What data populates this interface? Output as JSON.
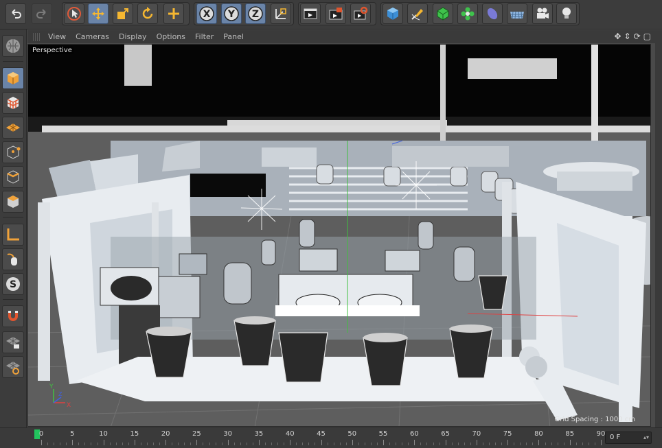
{
  "toolbar": {
    "buttons": [
      {
        "icon": "undo-icon",
        "enabled": true
      },
      {
        "icon": "redo-icon",
        "enabled": false
      },
      {
        "icon": "selection-arrow-icon",
        "enabled": true
      },
      {
        "icon": "move-icon",
        "active": true
      },
      {
        "icon": "scale-icon",
        "enabled": true
      },
      {
        "icon": "rotate-icon",
        "enabled": true
      },
      {
        "icon": "plus-move-icon",
        "enabled": true
      },
      {
        "icon": "x-axis-lock-icon",
        "label": "X"
      },
      {
        "icon": "y-axis-lock-icon",
        "label": "Y"
      },
      {
        "icon": "z-axis-lock-icon",
        "label": "Z"
      },
      {
        "icon": "coordinate-system-icon"
      },
      {
        "icon": "render-view-icon"
      },
      {
        "icon": "render-picture-viewer-icon"
      },
      {
        "icon": "render-settings-icon"
      },
      {
        "icon": "cube-primitive-icon"
      },
      {
        "icon": "spline-pen-icon"
      },
      {
        "icon": "subdivision-icon"
      },
      {
        "icon": "mograph-cloner-icon"
      },
      {
        "icon": "deformer-icon"
      },
      {
        "icon": "floor-icon"
      },
      {
        "icon": "camera-icon"
      },
      {
        "icon": "light-bulb-icon"
      }
    ]
  },
  "viewport_menu": [
    "View",
    "Cameras",
    "Display",
    "Options",
    "Filter",
    "Panel"
  ],
  "viewport": {
    "camera_label": "Perspective",
    "grid_spacing": "Grid Spacing : 1000 cm",
    "axis_labels": {
      "y": "Y",
      "x": "X",
      "z": "Z"
    }
  },
  "left_palette": [
    "model-mode-icon",
    "texture-mode-icon",
    "workplane-mode-icon",
    "points-mode-icon",
    "edges-mode-icon",
    "polygons-mode-icon",
    "axis-mode-icon",
    "tweak-mode-icon",
    "solo-mode-icon",
    "magnet-icon",
    "snap-grid-lock-icon",
    "workplane-lock-icon"
  ],
  "timeline": {
    "ticks": [
      "0",
      "5",
      "10",
      "15",
      "20",
      "25",
      "30",
      "35",
      "40",
      "45",
      "50",
      "55",
      "60",
      "65",
      "70",
      "75",
      "80",
      "85",
      "90"
    ],
    "current_frame_field": "0 F"
  },
  "colors": {
    "accent": "#6a84a8",
    "playhead": "#22c55e",
    "axis_x": "#e04040",
    "axis_y": "#40c040",
    "axis_z": "#4060e0"
  }
}
